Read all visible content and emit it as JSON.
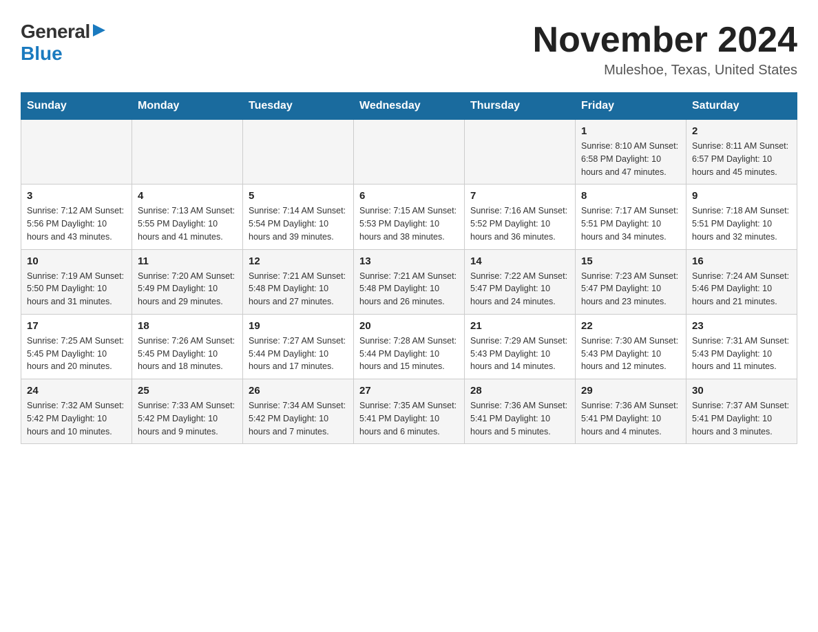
{
  "header": {
    "logo_general": "General",
    "logo_blue": "Blue",
    "month_title": "November 2024",
    "location": "Muleshoe, Texas, United States"
  },
  "calendar": {
    "days_of_week": [
      "Sunday",
      "Monday",
      "Tuesday",
      "Wednesday",
      "Thursday",
      "Friday",
      "Saturday"
    ],
    "rows": [
      {
        "cells": [
          {
            "day": "",
            "info": ""
          },
          {
            "day": "",
            "info": ""
          },
          {
            "day": "",
            "info": ""
          },
          {
            "day": "",
            "info": ""
          },
          {
            "day": "",
            "info": ""
          },
          {
            "day": "1",
            "info": "Sunrise: 8:10 AM\nSunset: 6:58 PM\nDaylight: 10 hours and 47 minutes."
          },
          {
            "day": "2",
            "info": "Sunrise: 8:11 AM\nSunset: 6:57 PM\nDaylight: 10 hours and 45 minutes."
          }
        ]
      },
      {
        "cells": [
          {
            "day": "3",
            "info": "Sunrise: 7:12 AM\nSunset: 5:56 PM\nDaylight: 10 hours and 43 minutes."
          },
          {
            "day": "4",
            "info": "Sunrise: 7:13 AM\nSunset: 5:55 PM\nDaylight: 10 hours and 41 minutes."
          },
          {
            "day": "5",
            "info": "Sunrise: 7:14 AM\nSunset: 5:54 PM\nDaylight: 10 hours and 39 minutes."
          },
          {
            "day": "6",
            "info": "Sunrise: 7:15 AM\nSunset: 5:53 PM\nDaylight: 10 hours and 38 minutes."
          },
          {
            "day": "7",
            "info": "Sunrise: 7:16 AM\nSunset: 5:52 PM\nDaylight: 10 hours and 36 minutes."
          },
          {
            "day": "8",
            "info": "Sunrise: 7:17 AM\nSunset: 5:51 PM\nDaylight: 10 hours and 34 minutes."
          },
          {
            "day": "9",
            "info": "Sunrise: 7:18 AM\nSunset: 5:51 PM\nDaylight: 10 hours and 32 minutes."
          }
        ]
      },
      {
        "cells": [
          {
            "day": "10",
            "info": "Sunrise: 7:19 AM\nSunset: 5:50 PM\nDaylight: 10 hours and 31 minutes."
          },
          {
            "day": "11",
            "info": "Sunrise: 7:20 AM\nSunset: 5:49 PM\nDaylight: 10 hours and 29 minutes."
          },
          {
            "day": "12",
            "info": "Sunrise: 7:21 AM\nSunset: 5:48 PM\nDaylight: 10 hours and 27 minutes."
          },
          {
            "day": "13",
            "info": "Sunrise: 7:21 AM\nSunset: 5:48 PM\nDaylight: 10 hours and 26 minutes."
          },
          {
            "day": "14",
            "info": "Sunrise: 7:22 AM\nSunset: 5:47 PM\nDaylight: 10 hours and 24 minutes."
          },
          {
            "day": "15",
            "info": "Sunrise: 7:23 AM\nSunset: 5:47 PM\nDaylight: 10 hours and 23 minutes."
          },
          {
            "day": "16",
            "info": "Sunrise: 7:24 AM\nSunset: 5:46 PM\nDaylight: 10 hours and 21 minutes."
          }
        ]
      },
      {
        "cells": [
          {
            "day": "17",
            "info": "Sunrise: 7:25 AM\nSunset: 5:45 PM\nDaylight: 10 hours and 20 minutes."
          },
          {
            "day": "18",
            "info": "Sunrise: 7:26 AM\nSunset: 5:45 PM\nDaylight: 10 hours and 18 minutes."
          },
          {
            "day": "19",
            "info": "Sunrise: 7:27 AM\nSunset: 5:44 PM\nDaylight: 10 hours and 17 minutes."
          },
          {
            "day": "20",
            "info": "Sunrise: 7:28 AM\nSunset: 5:44 PM\nDaylight: 10 hours and 15 minutes."
          },
          {
            "day": "21",
            "info": "Sunrise: 7:29 AM\nSunset: 5:43 PM\nDaylight: 10 hours and 14 minutes."
          },
          {
            "day": "22",
            "info": "Sunrise: 7:30 AM\nSunset: 5:43 PM\nDaylight: 10 hours and 12 minutes."
          },
          {
            "day": "23",
            "info": "Sunrise: 7:31 AM\nSunset: 5:43 PM\nDaylight: 10 hours and 11 minutes."
          }
        ]
      },
      {
        "cells": [
          {
            "day": "24",
            "info": "Sunrise: 7:32 AM\nSunset: 5:42 PM\nDaylight: 10 hours and 10 minutes."
          },
          {
            "day": "25",
            "info": "Sunrise: 7:33 AM\nSunset: 5:42 PM\nDaylight: 10 hours and 9 minutes."
          },
          {
            "day": "26",
            "info": "Sunrise: 7:34 AM\nSunset: 5:42 PM\nDaylight: 10 hours and 7 minutes."
          },
          {
            "day": "27",
            "info": "Sunrise: 7:35 AM\nSunset: 5:41 PM\nDaylight: 10 hours and 6 minutes."
          },
          {
            "day": "28",
            "info": "Sunrise: 7:36 AM\nSunset: 5:41 PM\nDaylight: 10 hours and 5 minutes."
          },
          {
            "day": "29",
            "info": "Sunrise: 7:36 AM\nSunset: 5:41 PM\nDaylight: 10 hours and 4 minutes."
          },
          {
            "day": "30",
            "info": "Sunrise: 7:37 AM\nSunset: 5:41 PM\nDaylight: 10 hours and 3 minutes."
          }
        ]
      }
    ]
  }
}
